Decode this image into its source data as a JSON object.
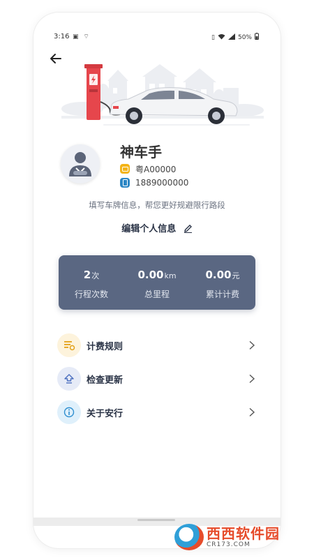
{
  "status_bar": {
    "time": "3:16",
    "battery": "50%"
  },
  "profile": {
    "name": "神车手",
    "plate": "粤A00000",
    "phone": "1889000000",
    "hint": "填写车牌信息，帮您更好规避限行路段",
    "edit_label": "编辑个人信息"
  },
  "stats": [
    {
      "value": "2",
      "unit": "次",
      "label": "行程次数"
    },
    {
      "value": "0.00",
      "unit": "km",
      "label": "总里程"
    },
    {
      "value": "0.00",
      "unit": "元",
      "label": "累计计费"
    }
  ],
  "menu": [
    {
      "label": "计费规则",
      "icon": "billing-rules-icon"
    },
    {
      "label": "检查更新",
      "icon": "update-icon"
    },
    {
      "label": "关于安行",
      "icon": "info-icon"
    }
  ],
  "watermark": {
    "main": "西西软件园",
    "sub": "CR173.COM"
  },
  "colors": {
    "stats_card": "#5a6782",
    "charger_red": "#e6464c",
    "plate_icon": "#f3b418",
    "phone_icon": "#2b86c5"
  }
}
